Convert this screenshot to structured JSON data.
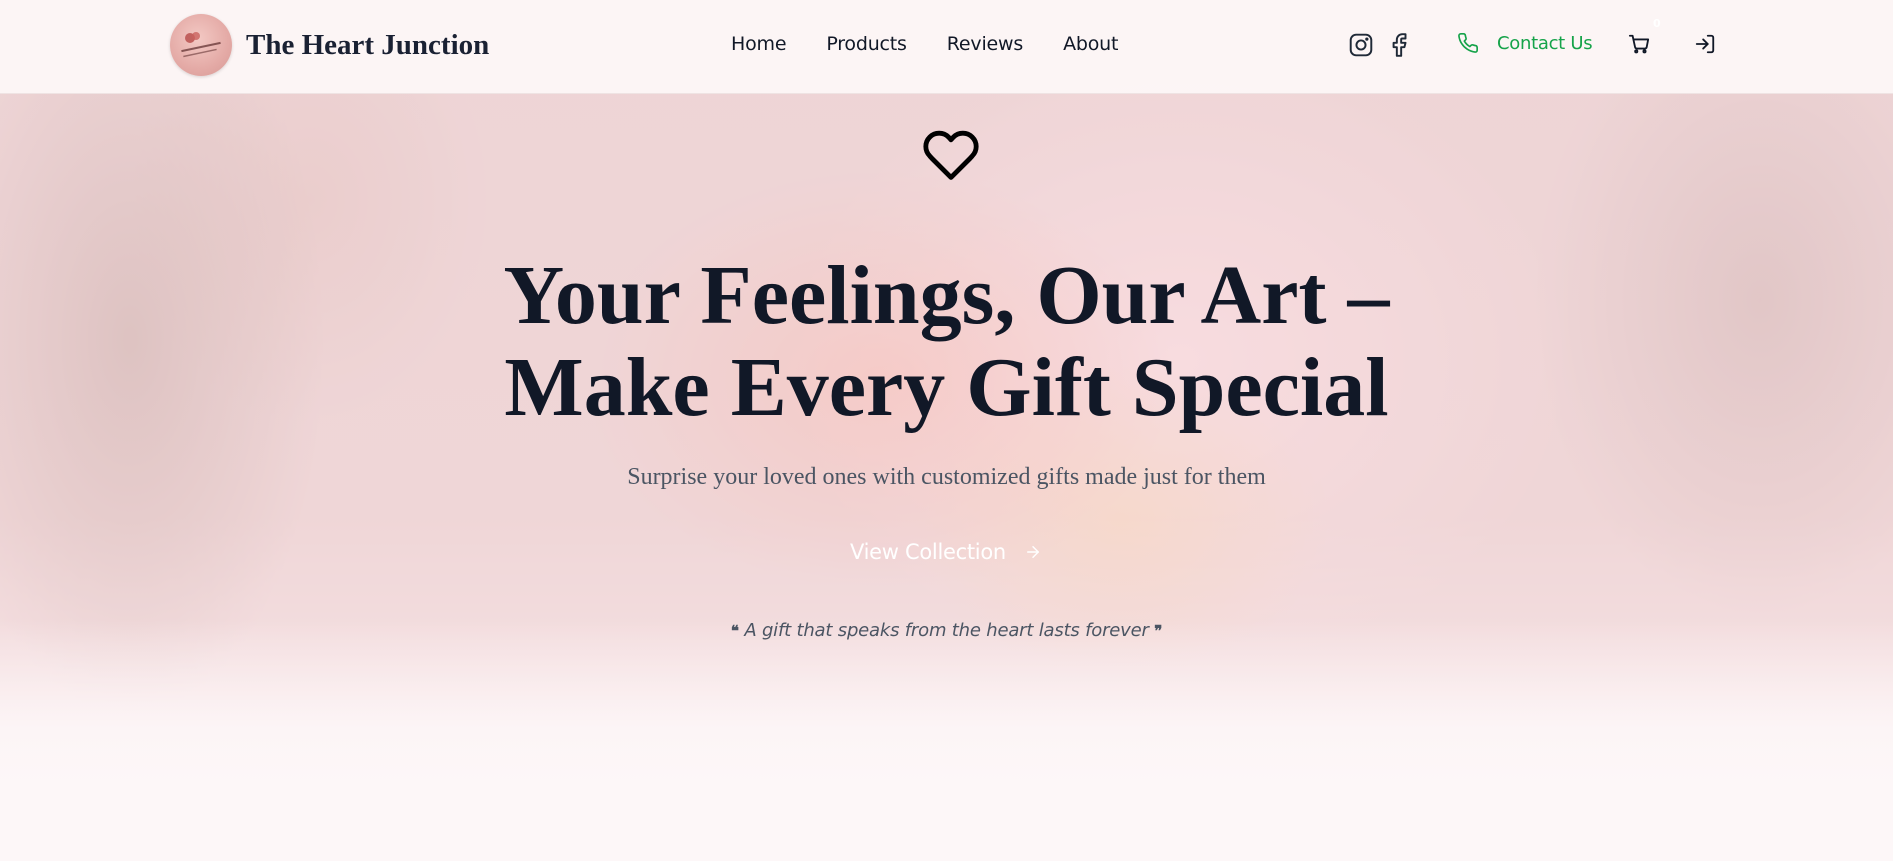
{
  "brand": {
    "name": "The Heart Junction",
    "logo_text": "THE HEART JUNCTION"
  },
  "nav": {
    "items": [
      {
        "label": "Home"
      },
      {
        "label": "Products"
      },
      {
        "label": "Reviews"
      },
      {
        "label": "About"
      }
    ]
  },
  "header_actions": {
    "social_icons": [
      "instagram-icon",
      "facebook-icon"
    ],
    "contact_label": "Contact Us",
    "contact_icon": "phone-icon",
    "cart_icon": "shopping-cart-icon",
    "cart_count": "0",
    "login_icon": "log-in-icon"
  },
  "hero": {
    "icon": "heart-icon",
    "headline_line1": "Your Feelings, Our Art –",
    "headline_line2": "Make Every Gift Special",
    "subheadline": "Surprise your loved ones with customized gifts made just for them",
    "cta_label": "View Collection",
    "cta_icon": "arrow-right-icon",
    "quote_open": "❝",
    "quote_text": "A gift that speaks from the heart lasts forever",
    "quote_close": "❞"
  },
  "colors": {
    "accent_green": "#16a34a",
    "text_dark": "#111827",
    "text_muted": "#4b5563",
    "header_bg": "#fdf7f7",
    "hero_tint": "#ffecf0"
  }
}
